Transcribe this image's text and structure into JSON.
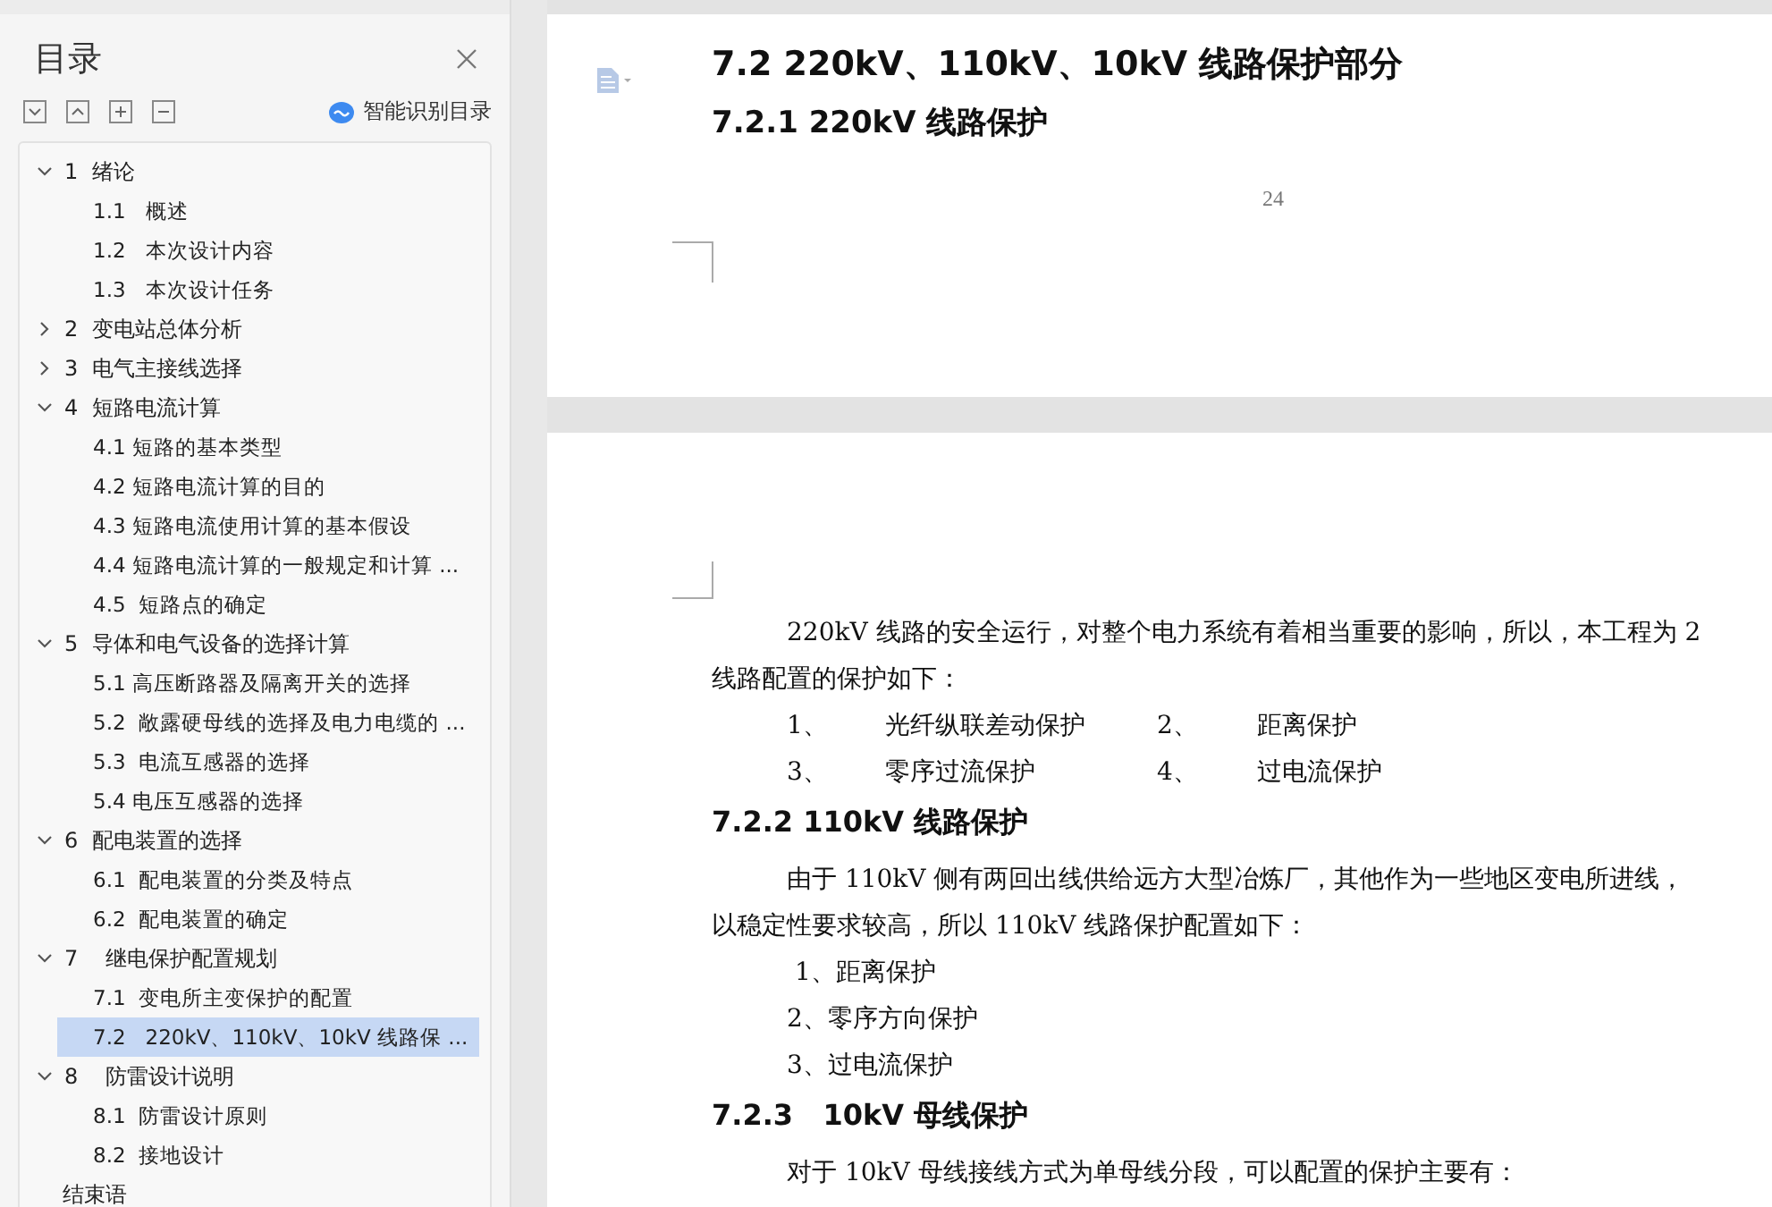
{
  "sidebar": {
    "title": "目录",
    "smart_toc": "智能识别目录",
    "toc": [
      {
        "label": "1  绪论",
        "expanded": true,
        "selected": false,
        "children": [
          {
            "label": "1.1   概述",
            "selected": false
          },
          {
            "label": "1.2   本次设计内容",
            "selected": false
          },
          {
            "label": "1.3   本次设计任务",
            "selected": false
          }
        ]
      },
      {
        "label": "2  变电站总体分析",
        "expanded": false,
        "selected": false
      },
      {
        "label": "3  电气主接线选择",
        "expanded": false,
        "selected": false
      },
      {
        "label": "4  短路电流计算",
        "expanded": true,
        "selected": false,
        "children": [
          {
            "label": "4.1 短路的基本类型",
            "selected": false
          },
          {
            "label": "4.2 短路电流计算的目的",
            "selected": false
          },
          {
            "label": "4.3 短路电流使用计算的基本假设",
            "selected": false
          },
          {
            "label": "4.4 短路电流计算的一般规定和计算 ...",
            "selected": false
          },
          {
            "label": "4.5  短路点的确定",
            "selected": false
          }
        ]
      },
      {
        "label": "5  导体和电气设备的选择计算",
        "expanded": true,
        "selected": false,
        "children": [
          {
            "label": "5.1 高压断路器及隔离开关的选择",
            "selected": false
          },
          {
            "label": "5.2  敞露硬母线的选择及电力电缆的 ...",
            "selected": false
          },
          {
            "label": "5.3  电流互感器的选择",
            "selected": false
          },
          {
            "label": "5.4 电压互感器的选择",
            "selected": false
          }
        ]
      },
      {
        "label": "6  配电装置的选择",
        "expanded": true,
        "selected": false,
        "children": [
          {
            "label": "6.1  配电装置的分类及特点",
            "selected": false
          },
          {
            "label": "6.2  配电装置的确定",
            "selected": false
          }
        ]
      },
      {
        "label": "7    继电保护配置规划",
        "expanded": true,
        "selected": false,
        "children": [
          {
            "label": "7.1  变电所主变保护的配置",
            "selected": false
          },
          {
            "label": "7.2   220kV、110kV、10kV 线路保 ...",
            "selected": true
          }
        ]
      },
      {
        "label": "8    防雷设计说明",
        "expanded": true,
        "selected": false,
        "children": [
          {
            "label": "8.1  防雷设计原则",
            "selected": false
          },
          {
            "label": "8.2  接地设计",
            "selected": false
          }
        ]
      },
      {
        "label": "结束语",
        "selected": false
      }
    ]
  },
  "page_1": {
    "heading": "7.2   220kV、110kV、10kV 线路保护部分",
    "subheading": "7.2.1 220kV 线路保护",
    "page_number": "24"
  },
  "page_2": {
    "blocks": [
      {
        "kind": "paragraph",
        "text": "220kV 线路的安全运行，对整个电力系统有着相当重要的影响，所以，本工程为 2"
      },
      {
        "kind": "line",
        "text": "线路配置的保护如下："
      },
      {
        "kind": "pairs",
        "items": [
          {
            "number": "1、",
            "text": "光纤纵联差动保护"
          },
          {
            "number": "2、",
            "text": "距离保护"
          },
          {
            "number": "3、",
            "text": "零序过流保护"
          },
          {
            "number": "4、",
            "text": "过电流保护"
          }
        ]
      },
      {
        "kind": "heading",
        "text": "7.2.2 110kV 线路保护"
      },
      {
        "kind": "paragraph",
        "text": "由于 110kV 侧有两回出线供给远方大型冶炼厂，其他作为一些地区变电所进线，"
      },
      {
        "kind": "line",
        "text": "以稳定性要求较高，所以 110kV 线路保护配置如下："
      },
      {
        "kind": "item",
        "text": " 1、距离保护"
      },
      {
        "kind": "item",
        "text": "2、零序方向保护"
      },
      {
        "kind": "item",
        "text": "3、过电流保护"
      },
      {
        "kind": "heading",
        "text": "7.2.3   10kV 母线保护"
      },
      {
        "kind": "paragraph",
        "text": "对于 10kV 母线接线方式为单母线分段，可以配置的保护主要有："
      }
    ]
  }
}
